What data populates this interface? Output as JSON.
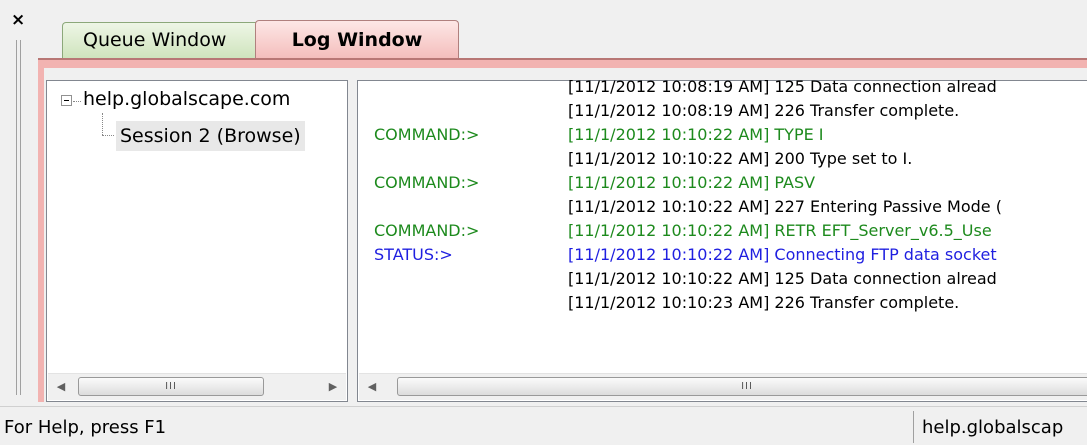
{
  "window": {
    "close_glyph": "×"
  },
  "tabs": [
    {
      "label": "Queue Window",
      "active": false
    },
    {
      "label": "Log Window",
      "active": true
    }
  ],
  "colors": {
    "log_tab": "#f4bebc",
    "queue_tab": "#cfe4bd",
    "command_text": "#1d8a1d",
    "status_text": "#1f1fe0"
  },
  "tree": {
    "root_label": "help.globalscape.com",
    "children": [
      {
        "label": "Session 2 (Browse)",
        "selected": true
      }
    ]
  },
  "log": {
    "entries": [
      {
        "prefix": "",
        "message": "[11/1/2012 10:08:19 AM] 125 Data connection alread",
        "type": "response"
      },
      {
        "prefix": "",
        "message": "[11/1/2012 10:08:19 AM] 226 Transfer complete.",
        "type": "response"
      },
      {
        "prefix": "COMMAND:>",
        "message": "[11/1/2012 10:10:22 AM] TYPE I",
        "type": "command"
      },
      {
        "prefix": "",
        "message": "[11/1/2012 10:10:22 AM] 200 Type set to I.",
        "type": "response"
      },
      {
        "prefix": "COMMAND:>",
        "message": "[11/1/2012 10:10:22 AM] PASV",
        "type": "command"
      },
      {
        "prefix": "",
        "message": "[11/1/2012 10:10:22 AM] 227 Entering Passive Mode (",
        "type": "response"
      },
      {
        "prefix": "COMMAND:>",
        "message": "[11/1/2012 10:10:22 AM] RETR EFT_Server_v6.5_Use",
        "type": "command"
      },
      {
        "prefix": "STATUS:>",
        "message": "[11/1/2012 10:10:22 AM] Connecting FTP data socket",
        "type": "status"
      },
      {
        "prefix": "",
        "message": "[11/1/2012 10:10:22 AM] 125 Data connection alread",
        "type": "response"
      },
      {
        "prefix": "",
        "message": "[11/1/2012 10:10:23 AM] 226 Transfer complete.",
        "type": "response"
      }
    ]
  },
  "scrollbars": {
    "left_arrow": "◀",
    "right_arrow": "▶",
    "thumb_grip": "III"
  },
  "statusbar": {
    "help_text": "For Help, press F1",
    "host_text": "help.globalscap"
  }
}
